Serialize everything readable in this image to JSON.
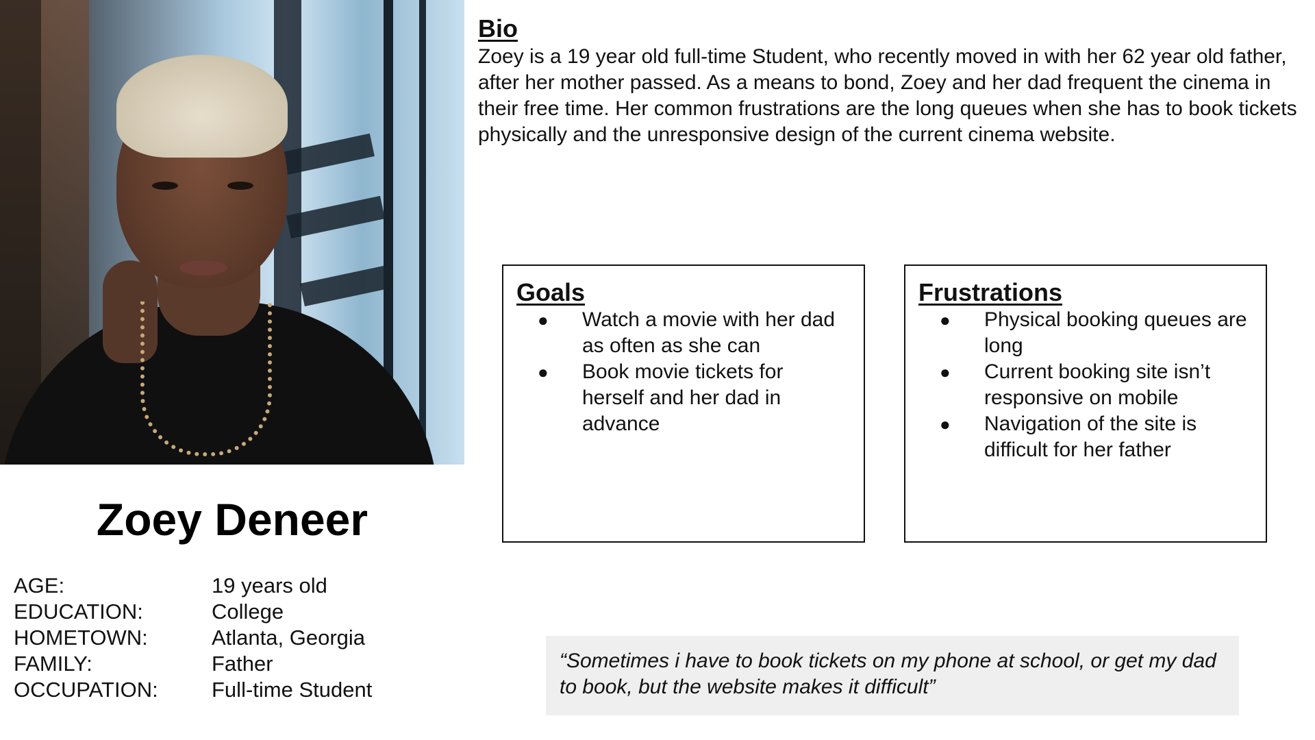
{
  "persona": {
    "name": "Zoey Deneer",
    "details": [
      {
        "label": "AGE:",
        "value": "19 years old"
      },
      {
        "label": "EDUCATION:",
        "value": "College"
      },
      {
        "label": "HOMETOWN:",
        "value": "Atlanta, Georgia"
      },
      {
        "label": "FAMILY:",
        "value": "Father"
      },
      {
        "label": "OCCUPATION:",
        "value": "Full-time Student"
      }
    ]
  },
  "bio": {
    "title": "Bio",
    "text": "Zoey is a 19 year old full-time Student, who recently moved in with her 62 year old father, after her mother passed. As a means to bond, Zoey and her dad frequent the cinema in their free time. Her common frustrations are the long queues when she has to book tickets physically and the unresponsive design of the current cinema website."
  },
  "goals": {
    "title": "Goals",
    "items": [
      "Watch a movie with her dad as often as she can",
      "Book movie tickets for herself and her dad in advance"
    ]
  },
  "frustrations": {
    "title": "Frustrations",
    "items": [
      "Physical booking queues are long",
      "Current booking site isn’t responsive on mobile",
      "Navigation of the site is difficult for her father"
    ]
  },
  "quote": {
    "text": "“Sometimes i have to book tickets on my phone at school, or get my dad to book, but the website makes it difficult”"
  },
  "bullet_glyph": "●",
  "colors": {
    "quote_background": "#efefef",
    "box_border": "#111111"
  }
}
